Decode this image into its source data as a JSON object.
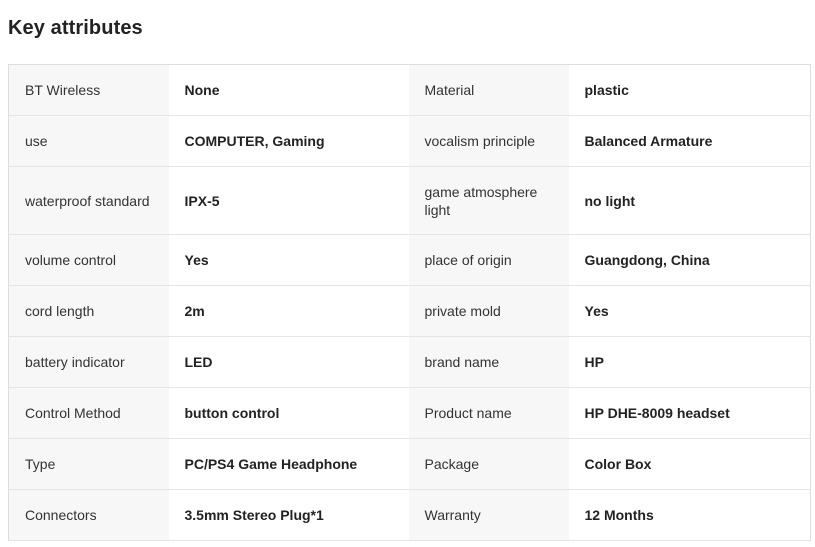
{
  "section": {
    "title": "Key attributes"
  },
  "rows": [
    [
      {
        "key": "BT Wireless",
        "value": "None"
      },
      {
        "key": "Material",
        "value": "plastic"
      }
    ],
    [
      {
        "key": "use",
        "value": "COMPUTER, Gaming"
      },
      {
        "key": "vocalism principle",
        "value": "Balanced Armature"
      }
    ],
    [
      {
        "key": "waterproof standard",
        "value": "IPX-5"
      },
      {
        "key": "game atmosphere light",
        "value": "no light"
      }
    ],
    [
      {
        "key": "volume control",
        "value": "Yes"
      },
      {
        "key": "place of origin",
        "value": "Guangdong, China"
      }
    ],
    [
      {
        "key": "cord length",
        "value": "2m"
      },
      {
        "key": "private mold",
        "value": "Yes"
      }
    ],
    [
      {
        "key": "battery indicator",
        "value": "LED"
      },
      {
        "key": "brand name",
        "value": "HP"
      }
    ],
    [
      {
        "key": "Control Method",
        "value": "button control"
      },
      {
        "key": "Product name",
        "value": "HP DHE-8009 headset"
      }
    ],
    [
      {
        "key": "Type",
        "value": "PC/PS4 Game Headphone"
      },
      {
        "key": "Package",
        "value": "Color Box"
      }
    ],
    [
      {
        "key": "Connectors",
        "value": "3.5mm Stereo Plug*1"
      },
      {
        "key": "Warranty",
        "value": "12 Months"
      }
    ]
  ]
}
